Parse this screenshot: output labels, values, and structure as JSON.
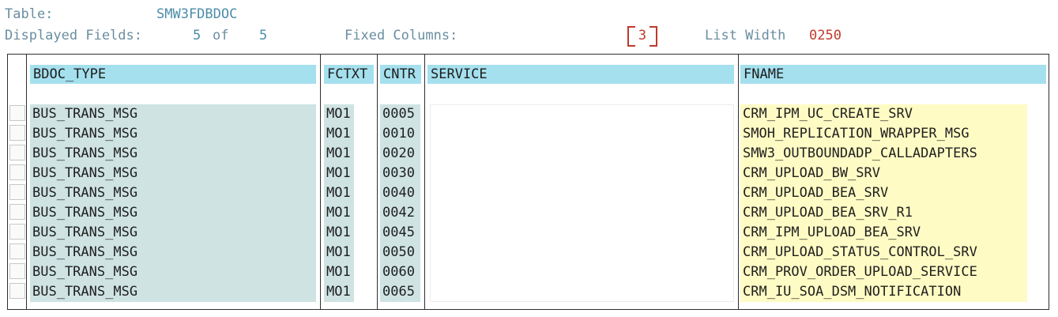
{
  "header": {
    "table_label": "Table:",
    "table_value": "SMW3FDBDOC",
    "fields_label": "Displayed Fields:",
    "fields_shown": "5",
    "fields_of": "of",
    "fields_total": "5",
    "fixed_label": "Fixed Columns:",
    "fixed_value": "3",
    "list_width_label": "List Width",
    "list_width_value": "0250"
  },
  "columns": [
    "BDOC_TYPE",
    "FCTXT",
    "CNTR",
    "SERVICE",
    "FNAME"
  ],
  "rows": [
    {
      "bdoc_type": "BUS_TRANS_MSG",
      "fctxt": "MO1",
      "cntr": "0005",
      "service": "",
      "fname": "CRM_IPM_UC_CREATE_SRV"
    },
    {
      "bdoc_type": "BUS_TRANS_MSG",
      "fctxt": "MO1",
      "cntr": "0010",
      "service": "",
      "fname": "SMOH_REPLICATION_WRAPPER_MSG"
    },
    {
      "bdoc_type": "BUS_TRANS_MSG",
      "fctxt": "MO1",
      "cntr": "0020",
      "service": "",
      "fname": "SMW3_OUTBOUNDADP_CALLADAPTERS"
    },
    {
      "bdoc_type": "BUS_TRANS_MSG",
      "fctxt": "MO1",
      "cntr": "0030",
      "service": "",
      "fname": "CRM_UPLOAD_BW_SRV"
    },
    {
      "bdoc_type": "BUS_TRANS_MSG",
      "fctxt": "MO1",
      "cntr": "0040",
      "service": "",
      "fname": "CRM_UPLOAD_BEA_SRV"
    },
    {
      "bdoc_type": "BUS_TRANS_MSG",
      "fctxt": "MO1",
      "cntr": "0042",
      "service": "",
      "fname": "CRM_UPLOAD_BEA_SRV_R1"
    },
    {
      "bdoc_type": "BUS_TRANS_MSG",
      "fctxt": "MO1",
      "cntr": "0045",
      "service": "",
      "fname": "CRM_IPM_UPLOAD_BEA_SRV"
    },
    {
      "bdoc_type": "BUS_TRANS_MSG",
      "fctxt": "MO1",
      "cntr": "0050",
      "service": "",
      "fname": "CRM_UPLOAD_STATUS_CONTROL_SRV"
    },
    {
      "bdoc_type": "BUS_TRANS_MSG",
      "fctxt": "MO1",
      "cntr": "0060",
      "service": "",
      "fname": "CRM_PROV_ORDER_UPLOAD_SERVICE"
    },
    {
      "bdoc_type": "BUS_TRANS_MSG",
      "fctxt": "MO1",
      "cntr": "0065",
      "service": "",
      "fname": "CRM_IU_SOA_DSM_NOTIFICATION"
    }
  ],
  "colors": {
    "header_bg": "#a5e0ee",
    "key_cell_bg": "#cfe3e3",
    "fname_bg": "#fffbc4",
    "accent_red": "#c0392b"
  }
}
